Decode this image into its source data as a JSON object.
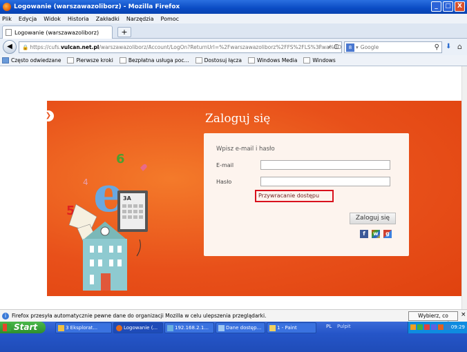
{
  "window": {
    "title": "Logowanie (warszawazoliborz) - Mozilla Firefox",
    "controls": [
      "_",
      "□",
      "X"
    ]
  },
  "menu": [
    "Plik",
    "Edycja",
    "Widok",
    "Historia",
    "Zakładki",
    "Narzędzia",
    "Pomoc"
  ],
  "tab": {
    "label": "Logowanie (warszawazoliborz)",
    "new_tab": "+"
  },
  "nav": {
    "url_prefix": "https://cufs.",
    "url_domain": "vulcan.net.pl",
    "url_rest": "/warszawazoliborz/Account/LogOn?ReturnUrl=%2Fwarszawazoliborz%2FFS%2FLS%3Fwa%3Dwsign",
    "search_placeholder": "Google"
  },
  "bookmarks": [
    "Często odwiedzane",
    "Pierwsze kroki",
    "Bezpłatna usługa poc...",
    "Dostosuj łącza",
    "Windows Media",
    "Windows"
  ],
  "login": {
    "title": "Zaloguj się",
    "hint": "Wpisz e-mail i hasło",
    "email_label": "E-mail",
    "password_label": "Hasło",
    "recover_link": "Przywracanie dostępu",
    "submit": "Zaloguj się",
    "social": [
      "f",
      "w",
      "g"
    ]
  },
  "status": {
    "message": "Firefox przesyła automatycznie pewne dane do organizacji Mozilla w celu ulepszenia przeglądarki.",
    "choose": "Wybierz, co udostępniać",
    "close": "×"
  },
  "taskbar": {
    "start": "Start",
    "buttons": [
      "3 Eksplorat...",
      "Logowanie (...",
      "192.168.2.1...",
      "Dane dostęp...",
      "1 - Paint"
    ],
    "lang": "PL",
    "desktop": "Pulpit",
    "clock": "09:29"
  },
  "colors": {
    "banner": "#e8501a",
    "recover_highlight": "#d8101c",
    "titlebar": "#0a4bc4"
  }
}
